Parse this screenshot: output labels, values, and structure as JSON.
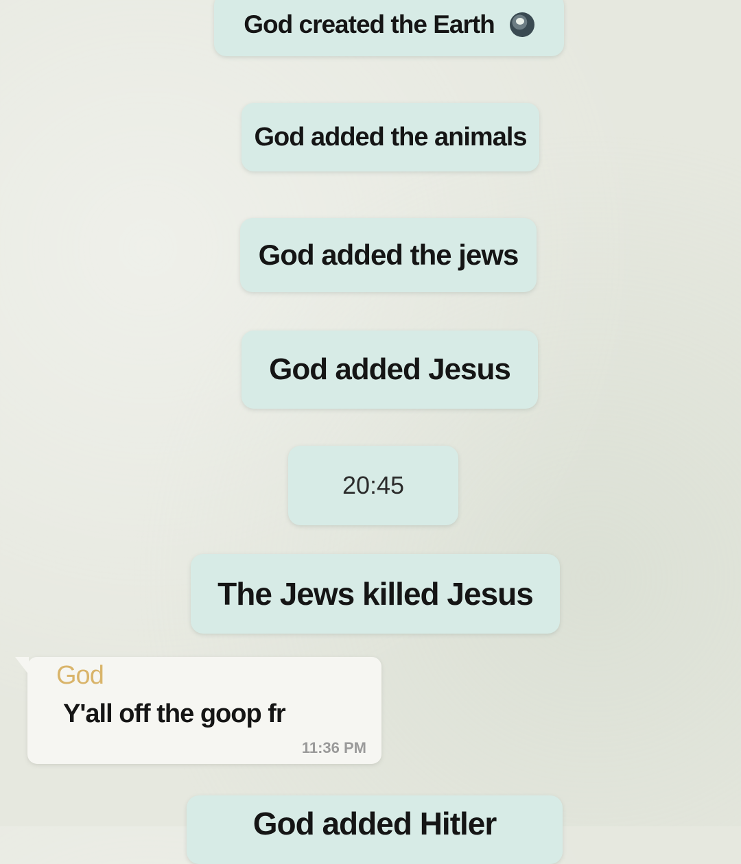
{
  "messages": {
    "m1": "God created the Earth",
    "m1_icon": "globe-icon",
    "m2": "God added the animals",
    "m3": "God added the jews",
    "m4": "God added Jesus",
    "timestamp": "20:45",
    "m5": "The Jews killed Jesus",
    "incoming": {
      "sender": "God",
      "text": "Y'all off the goop fr",
      "time": "11:36 PM"
    },
    "m6": "God added Hitler"
  },
  "colors": {
    "background": "#e6e8df",
    "system_bubble": "#d7ebe6",
    "incoming_bubble": "#f6f6f2",
    "sender_name": "#d9b46a"
  }
}
